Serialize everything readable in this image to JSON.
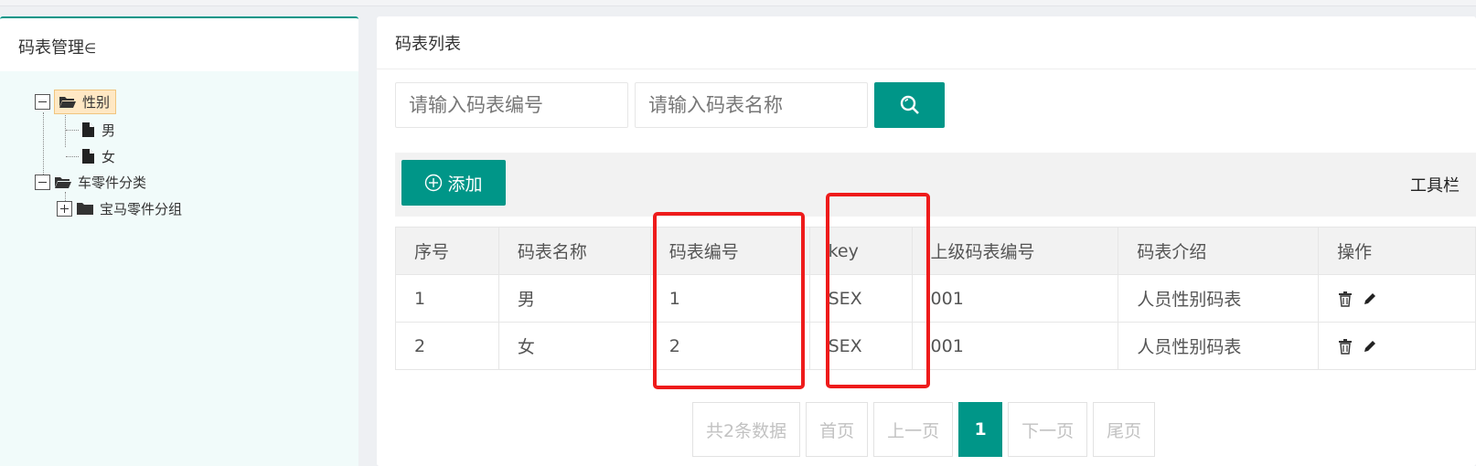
{
  "left_panel": {
    "title": "码表管理",
    "tree": [
      {
        "label": "性别",
        "expanded": true,
        "selected": true,
        "children": [
          {
            "label": "男"
          },
          {
            "label": "女"
          }
        ]
      },
      {
        "label": "车零件分类",
        "expanded": true,
        "children": [
          {
            "label": "宝马零件分组",
            "expanded": false
          }
        ]
      }
    ]
  },
  "right_panel": {
    "title": "码表列表",
    "search": {
      "code_placeholder": "请输入码表编号",
      "name_placeholder": "请输入码表名称",
      "button_icon": "search-icon"
    },
    "toolbar": {
      "add_label": "添加",
      "label": "工具栏"
    },
    "table": {
      "columns": [
        "序号",
        "码表名称",
        "码表编号",
        "key",
        "上级码表编号",
        "码表介绍",
        "操作"
      ],
      "rows": [
        {
          "index": "1",
          "name": "男",
          "code": "1",
          "key": "SEX",
          "parent_code": "001",
          "description": "人员性别码表"
        },
        {
          "index": "2",
          "name": "女",
          "code": "2",
          "key": "SEX",
          "parent_code": "001",
          "description": "人员性别码表"
        }
      ]
    },
    "pagination": {
      "total": "共2条数据",
      "first": "首页",
      "prev": "上一页",
      "current": "1",
      "next": "下一页",
      "last": "尾页"
    }
  },
  "colors": {
    "accent": "#009688",
    "highlight": "#ee1b1b",
    "selected_node": "#ffe8c4"
  }
}
